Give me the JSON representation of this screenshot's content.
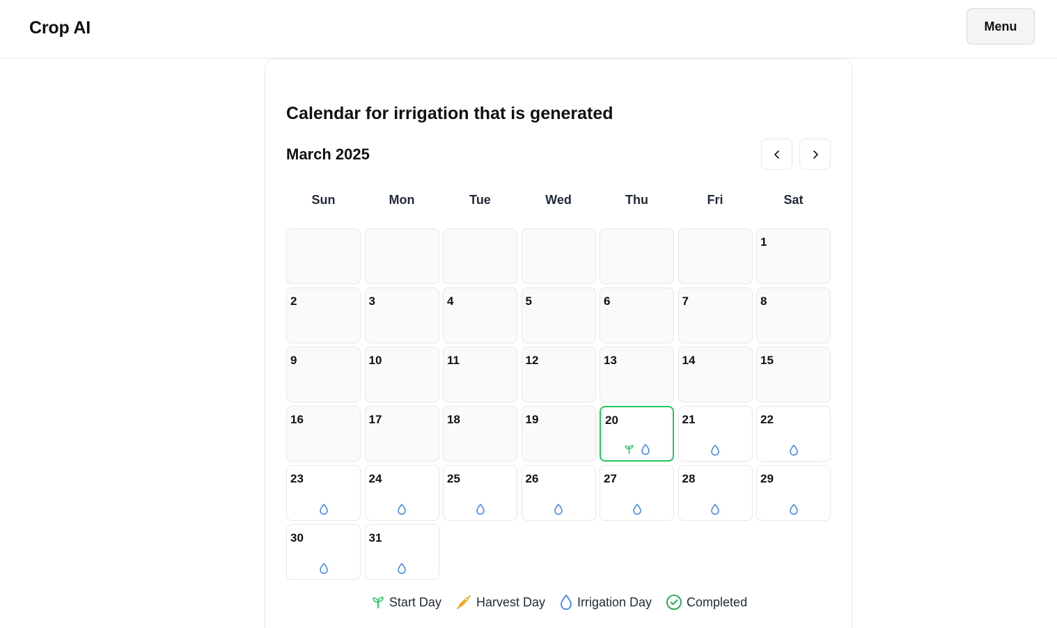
{
  "app": {
    "title": "Crop AI",
    "menu_label": "Menu"
  },
  "calendar": {
    "title": "Calendar for irrigation that is generated",
    "month_label": "March 2025",
    "weekdays": [
      "Sun",
      "Mon",
      "Tue",
      "Wed",
      "Thu",
      "Fri",
      "Sat"
    ],
    "days": [
      "1",
      "2",
      "3",
      "4",
      "5",
      "6",
      "7",
      "8",
      "9",
      "10",
      "11",
      "12",
      "13",
      "14",
      "15",
      "16",
      "17",
      "18",
      "19",
      "20",
      "21",
      "22",
      "23",
      "24",
      "25",
      "26",
      "27",
      "28",
      "29",
      "30",
      "31"
    ],
    "highlighted_day": "20",
    "irrigation_days": [
      "20",
      "21",
      "22",
      "23",
      "24",
      "25",
      "26",
      "27",
      "28",
      "29",
      "30",
      "31"
    ],
    "start_days": [
      "20"
    ]
  },
  "legend": {
    "start_label": "Start Day",
    "harvest_label": "Harvest Day",
    "irrigation_label": "Irrigation Day",
    "completed_label": "Completed"
  },
  "colors": {
    "start": "#22c55e",
    "harvest": "#f59e0b",
    "irrigation": "#3b82f6",
    "completed": "#16a34a",
    "today_border": "#22c55e"
  }
}
